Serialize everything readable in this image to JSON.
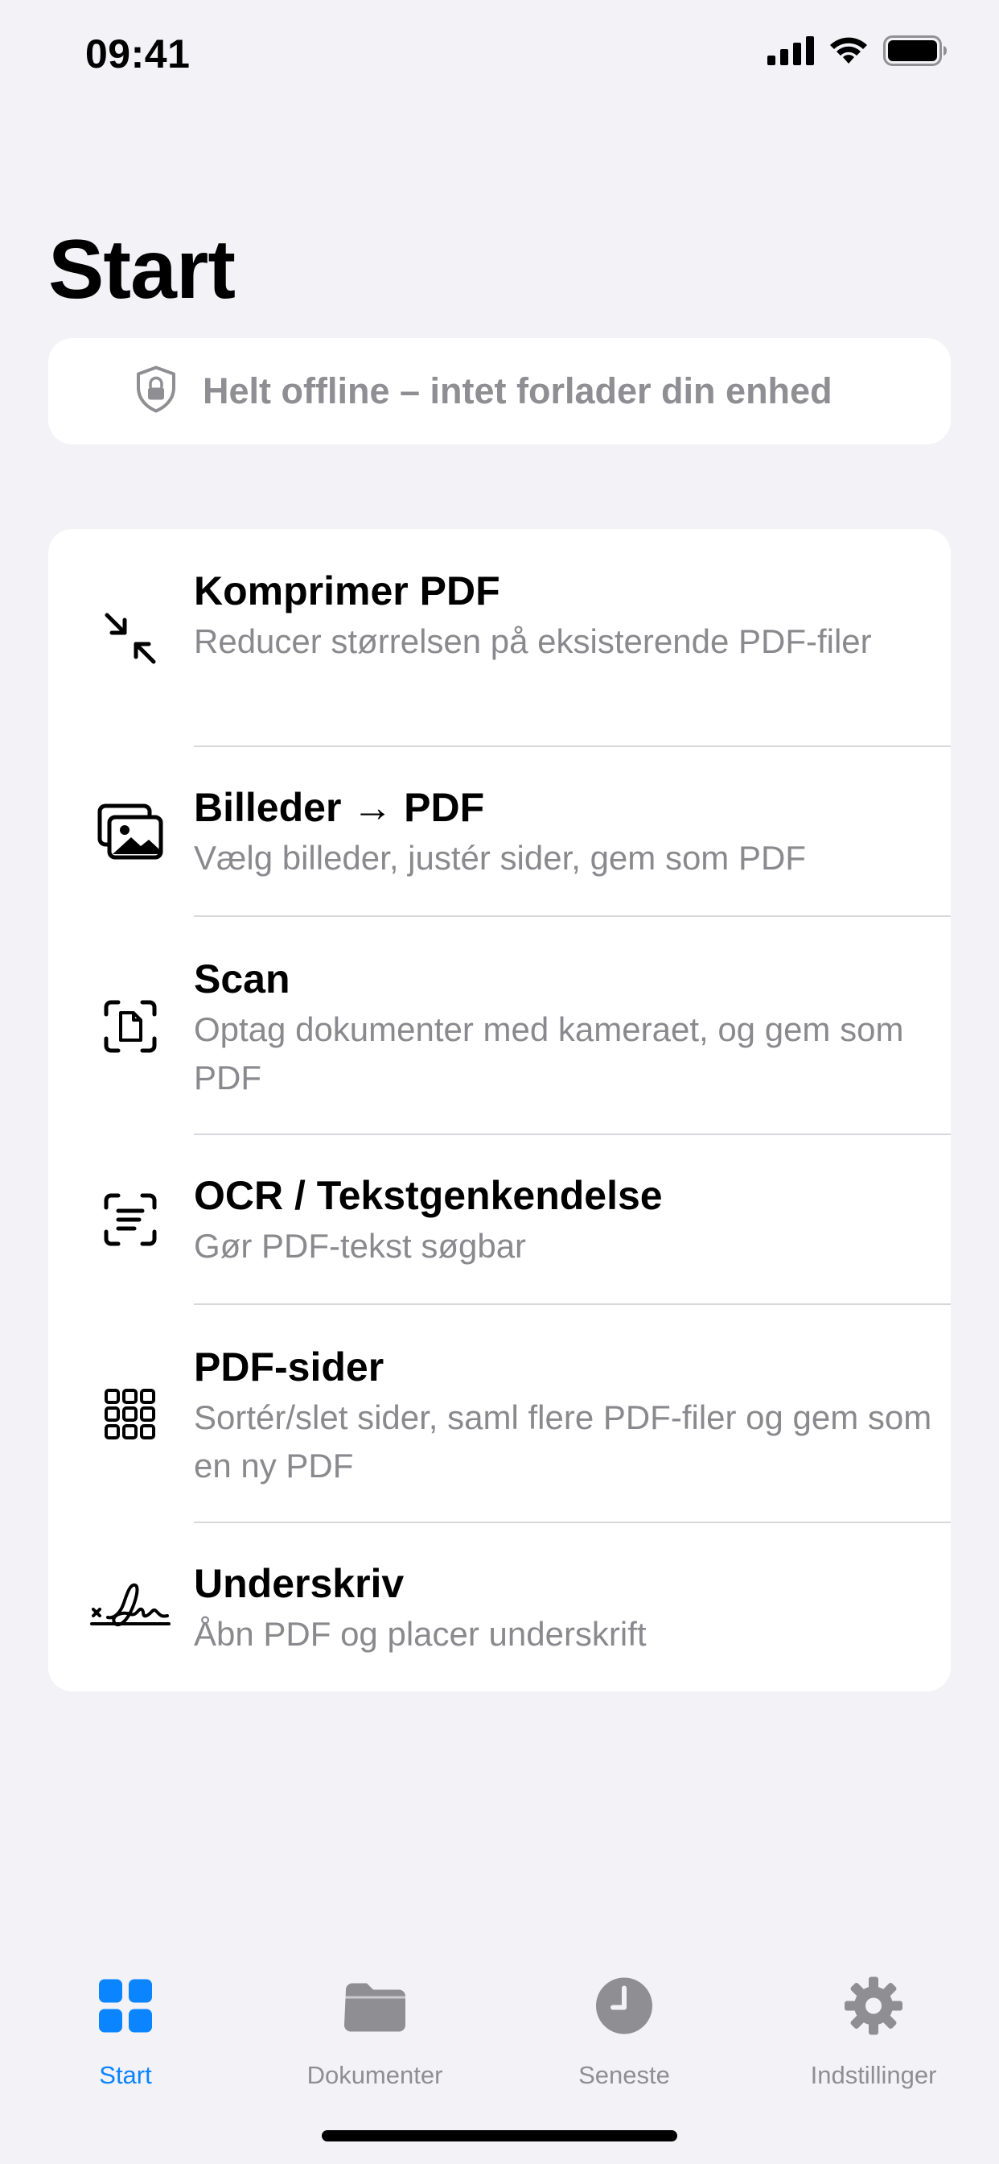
{
  "status_bar": {
    "time": "09:41"
  },
  "page": {
    "title": "Start"
  },
  "offline_banner": {
    "icon": "lock-shield-icon",
    "text": "Helt offline – intet forlader din enhed"
  },
  "tools": [
    {
      "icon": "compress-arrows-icon",
      "title": "Komprimer PDF",
      "subtitle": "Reducer størrelsen på eksisterende PDF-filer"
    },
    {
      "icon": "photos-icon",
      "title": "Billeder → PDF",
      "subtitle": "Vælg billeder, justér sider, gem som PDF"
    },
    {
      "icon": "document-scanner-icon",
      "title": "Scan",
      "subtitle": "Optag dokumenter med kameraet, og gem som PDF"
    },
    {
      "icon": "text-viewfinder-icon",
      "title": "OCR / Tekstgenkendelse",
      "subtitle": "Gør PDF-tekst søgbar"
    },
    {
      "icon": "grid-pages-icon",
      "title": "PDF-sider",
      "subtitle": "Sortér/slet sider, saml flere PDF-filer og gem som en ny PDF"
    },
    {
      "icon": "signature-icon",
      "title": "Underskriv",
      "subtitle": "Åbn PDF og placer underskrift"
    }
  ],
  "tab_bar": {
    "tabs": [
      {
        "label": "Start",
        "icon": "grid-icon",
        "active": true
      },
      {
        "label": "Dokumenter",
        "icon": "folder-icon",
        "active": false
      },
      {
        "label": "Seneste",
        "icon": "clock-icon",
        "active": false
      },
      {
        "label": "Indstillinger",
        "icon": "gear-icon",
        "active": false
      }
    ]
  },
  "colors": {
    "accent": "#0A84FF",
    "background": "#F2F2F7",
    "secondary_text": "#8A8A8E",
    "inactive_tab": "#8E8E93"
  }
}
